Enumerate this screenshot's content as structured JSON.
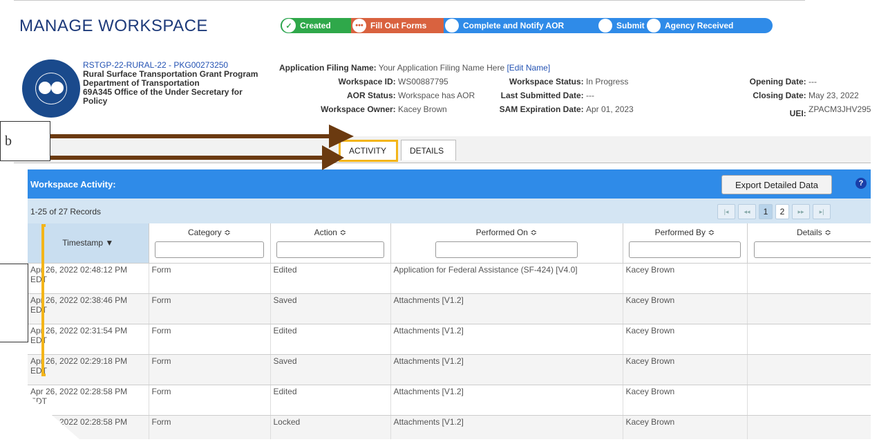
{
  "page": {
    "title": "MANAGE WORKSPACE"
  },
  "progress": {
    "steps": [
      {
        "label": "Created",
        "icon": "check-icon",
        "state": "done",
        "color": "#2fa84a"
      },
      {
        "label": "Fill Out Forms",
        "icon": "ellipsis-icon",
        "state": "current",
        "color": "#d9623f"
      },
      {
        "label": "Complete and Notify AOR",
        "state": "pending"
      },
      {
        "label": "Submit",
        "state": "pending"
      },
      {
        "label": "Agency Received",
        "state": "pending"
      }
    ],
    "check_glyph": "✓",
    "dots_glyph": "•••"
  },
  "opportunity": {
    "link": "RSTGP-22-RURAL-22 - PKG00273250",
    "name": "Rural Surface Transportation Grant Program",
    "agency": "Department of Transportation",
    "office": "69A345 Office of the Under Secretary for Policy"
  },
  "details": {
    "filing_name_label": "Application Filing Name:",
    "filing_name": "Your Application Filing Name Here",
    "edit_name": "[Edit Name]",
    "workspace_id_label": "Workspace ID:",
    "workspace_id": "WS00887795",
    "aor_status_label": "AOR Status:",
    "aor_status": "Workspace has AOR",
    "owner_label": "Workspace Owner:",
    "owner": "Kacey Brown",
    "status_label": "Workspace Status:",
    "status": "In Progress",
    "last_submitted_label": "Last Submitted Date:",
    "last_submitted": "---",
    "sam_label": "SAM Expiration Date:",
    "sam": "Apr 01, 2023",
    "opening_label": "Opening Date:",
    "opening": "---",
    "closing_label": "Closing Date:",
    "closing": "May 23, 2022",
    "uei_label": "UEI:",
    "uei": "ZPACM3JHV295"
  },
  "tabs": {
    "activity": "ACTIVITY",
    "details": "DETAILS"
  },
  "activity": {
    "title": "Workspace Activity:",
    "export": "Export Detailed Data",
    "help": "?",
    "records": "1-25 of 27 Records",
    "pages": [
      "1",
      "2"
    ],
    "pager_first": "|◂",
    "pager_prev": "◂◂",
    "pager_next": "▸▸",
    "pager_last": "▸|"
  },
  "table": {
    "columns": [
      "Timestamp ▼",
      "Category ≎",
      "Action ≎",
      "Performed On ≎",
      "Performed By ≎",
      "Details ≎"
    ],
    "rows": [
      [
        "Apr 26, 2022 02:48:12 PM EDT",
        "Form",
        "Edited",
        "Application for Federal Assistance (SF-424) [V4.0]",
        "Kacey Brown",
        ""
      ],
      [
        "Apr 26, 2022 02:38:46 PM EDT",
        "Form",
        "Saved",
        "Attachments [V1.2]",
        "Kacey Brown",
        ""
      ],
      [
        "Apr 26, 2022 02:31:54 PM EDT",
        "Form",
        "Edited",
        "Attachments [V1.2]",
        "Kacey Brown",
        ""
      ],
      [
        "Apr 26, 2022 02:29:18 PM EDT",
        "Form",
        "Saved",
        "Attachments [V1.2]",
        "Kacey Brown",
        ""
      ],
      [
        "Apr 26, 2022 02:28:58 PM EDT",
        "Form",
        "Edited",
        "Attachments [V1.2]",
        "Kacey Brown",
        ""
      ],
      [
        "2022 02:28:58 PM",
        "Form",
        "Locked",
        "Attachments [V1.2]",
        "Kacey Brown",
        ""
      ]
    ]
  },
  "annotation": {
    "label": "b",
    "arrow_color": "#6b3a10",
    "highlight_color": "#f3b51a"
  }
}
